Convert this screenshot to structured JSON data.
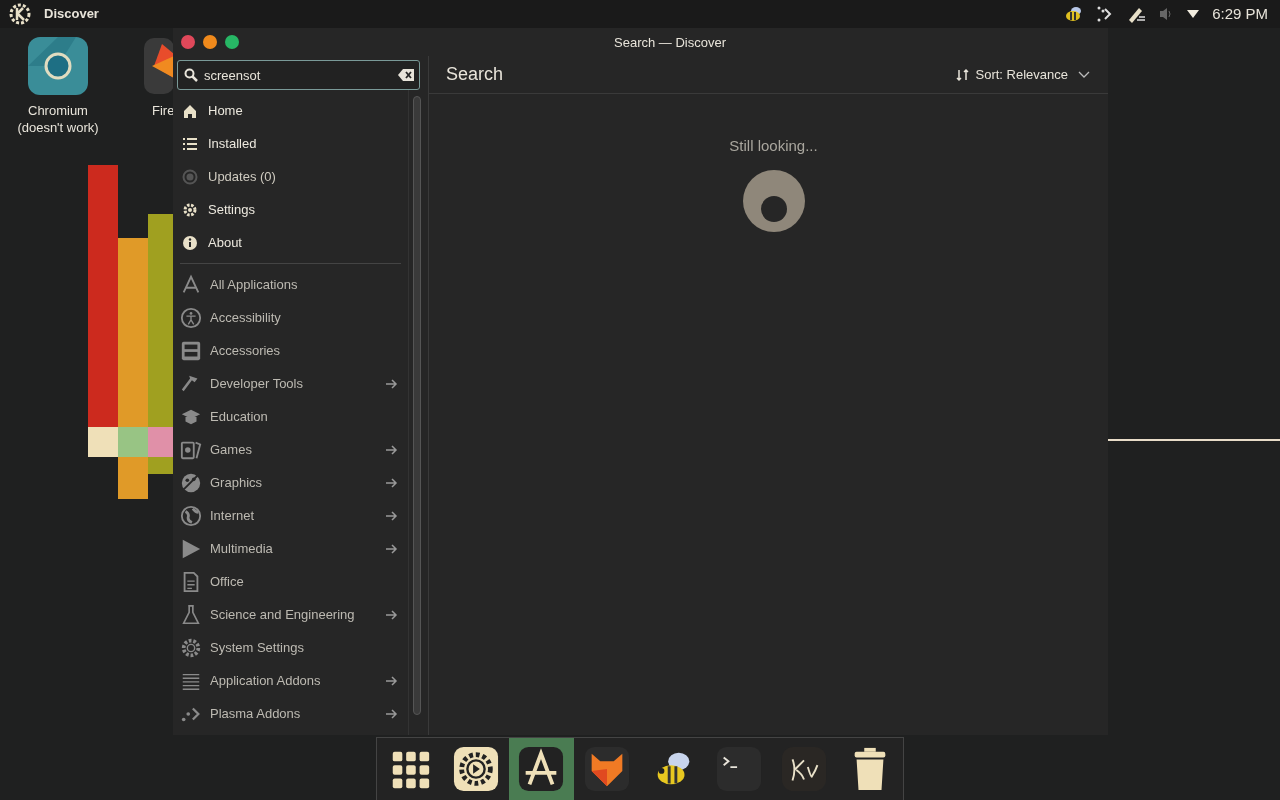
{
  "panel": {
    "app_name": "Discover",
    "clock": "6:29 PM"
  },
  "desktop_icons": [
    {
      "label": "Chromium\n(doesn't work)"
    },
    {
      "label": "Fire"
    }
  ],
  "window": {
    "title": "Search — Discover",
    "search": {
      "value": "screensot"
    },
    "sidebar": {
      "main_items": [
        {
          "label": "Home",
          "disabled": false
        },
        {
          "label": "Installed",
          "disabled": false
        },
        {
          "label": "Updates (0)",
          "disabled": true
        },
        {
          "label": "Settings",
          "disabled": false
        },
        {
          "label": "About",
          "disabled": false
        }
      ],
      "categories": [
        {
          "label": "All Applications",
          "has_submenu": false
        },
        {
          "label": "Accessibility",
          "has_submenu": false
        },
        {
          "label": "Accessories",
          "has_submenu": false
        },
        {
          "label": "Developer Tools",
          "has_submenu": true
        },
        {
          "label": "Education",
          "has_submenu": false
        },
        {
          "label": "Games",
          "has_submenu": true
        },
        {
          "label": "Graphics",
          "has_submenu": true
        },
        {
          "label": "Internet",
          "has_submenu": true
        },
        {
          "label": "Multimedia",
          "has_submenu": true
        },
        {
          "label": "Office",
          "has_submenu": false
        },
        {
          "label": "Science and Engineering",
          "has_submenu": true
        },
        {
          "label": "System Settings",
          "has_submenu": false
        },
        {
          "label": "Application Addons",
          "has_submenu": true
        },
        {
          "label": "Plasma Addons",
          "has_submenu": true
        }
      ]
    },
    "page_title": "Search",
    "sort": {
      "label": "Sort: Relevance"
    },
    "status": "Still looking..."
  },
  "dock": [
    {
      "kind": "grid",
      "selected": false
    },
    {
      "kind": "settings",
      "selected": false
    },
    {
      "kind": "discover",
      "selected": true
    },
    {
      "kind": "fox",
      "selected": false
    },
    {
      "kind": "bee",
      "selected": false
    },
    {
      "kind": "terminal",
      "selected": false
    },
    {
      "kind": "script",
      "selected": false
    },
    {
      "kind": "trash",
      "selected": false
    }
  ]
}
